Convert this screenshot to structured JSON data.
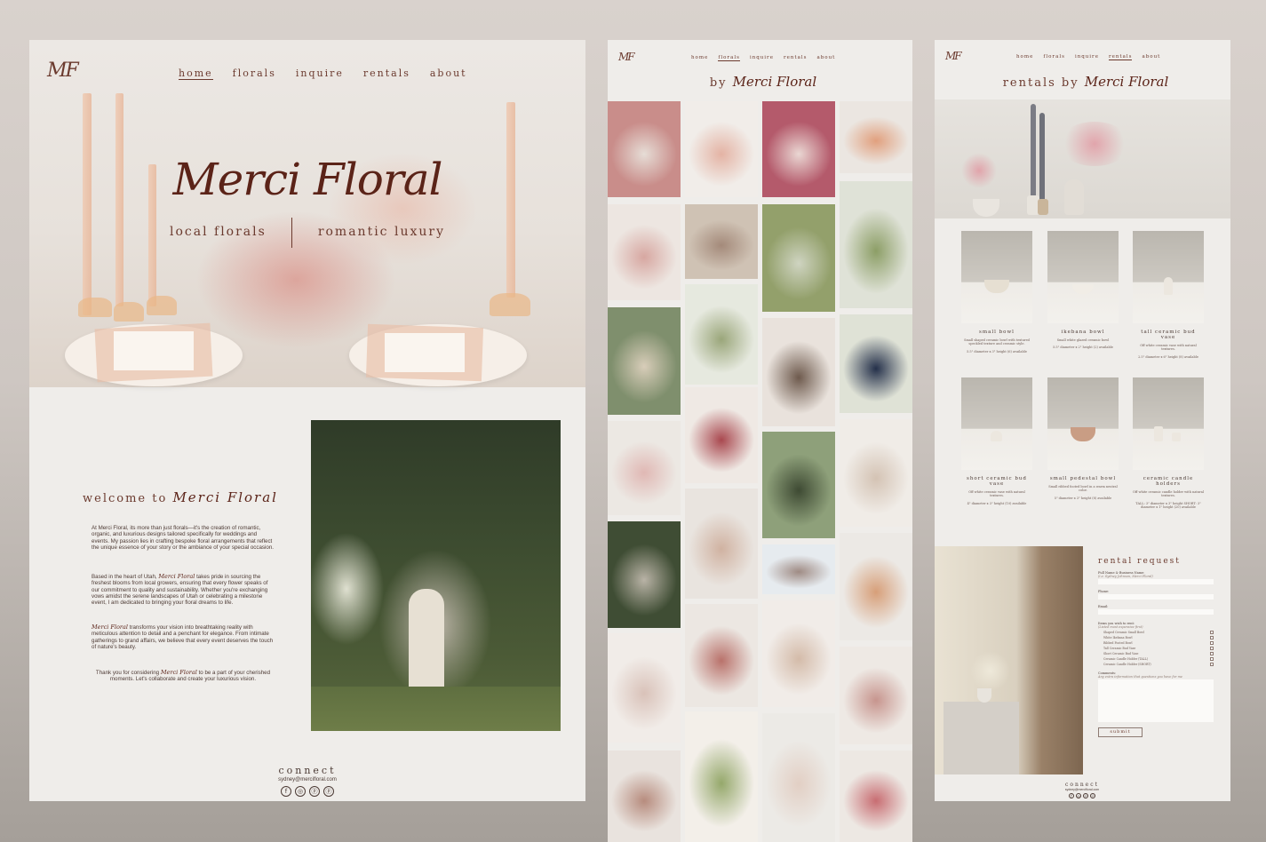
{
  "home": {
    "logo": "MF",
    "nav": [
      "home",
      "florals",
      "inquire",
      "rentals",
      "about"
    ],
    "active_nav": "home",
    "brand": "Merci Floral",
    "tagline_left": "local florals",
    "tagline_right": "romantic luxury",
    "welcome_prefix": "welcome to",
    "welcome_brand": "Merci Floral",
    "para1": "At Merci Floral, its more than just florals—it's the creation of romantic, organic, and luxurious designs tailored specifically for weddings and events. My passion lies in crafting bespoke floral arrangements that reflect the unique essence of your story or the ambiance of your special occasion.",
    "para2_lead": "Based in the heart of Utah,",
    "para2_brand": "Merci Floral",
    "para2_rest": "takes pride in sourcing the freshest blooms from local growers, ensuring that every flower speaks of our commitment to quality and sustainability. Whether you're exchanging vows amidst the serene landscapes of Utah or celebrating a milestone event, I am dedicated to bringing your floral dreams to life.",
    "para3_brand": "Merci Floral",
    "para3_rest": "transforms your vision into breathtaking reality with meticulous attention to detail and a penchant for elegance. From intimate gatherings to grand affairs, we believe that every event deserves the touch of nature's beauty.",
    "para4_lead": "Thank you for considering",
    "para4_brand": "Merci Floral",
    "para4_rest": "to be a part of your cherished moments. Let's collaborate and create your luxurious vision.",
    "connect_title": "connect",
    "email": "sydney@mercifloral.com",
    "socials": [
      "f",
      "◎",
      "ⓟ",
      "ⓟ"
    ]
  },
  "gallery": {
    "logo": "MF",
    "nav": [
      "home",
      "florals",
      "inquire",
      "rentals",
      "about"
    ],
    "active_nav": "florals",
    "title_prefix": "by",
    "title_brand": "Merci Floral"
  },
  "rentals": {
    "logo": "MF",
    "nav": [
      "home",
      "florals",
      "inquire",
      "rentals",
      "about"
    ],
    "active_nav": "rentals",
    "title_prefix": "rentals by",
    "title_brand": "Merci Floral",
    "products": [
      {
        "name": "small bowl",
        "desc": "Small shaped ceramic bowl with textured speckled texture and ceramic style.",
        "dims": "5.5\" diameter x 3\" height (6) available"
      },
      {
        "name": "ikebana bowl",
        "desc": "Small white glazed ceramic bowl",
        "dims": "5.5\" diameter x 2\" height (2) available"
      },
      {
        "name": "tall ceramic bud vase",
        "desc": "Off white ceramic vase with natural textures.",
        "dims": "2.5\" diameter x 6\" height (8) available"
      },
      {
        "name": "short ceramic bud vase",
        "desc": "Off white ceramic vase with natural textures.",
        "dims": "4\" diameter x 3\" height (10) available"
      },
      {
        "name": "small pedestal bowl",
        "desc": "Small ribbed footed bowl in a warm neutral color.",
        "dims": "5\" diameter x 3\" height (8) available"
      },
      {
        "name": "ceramic candle holders",
        "desc": "Off white ceramic candle holder with natural textures.",
        "dims": "TALL: 3\" diameter x 3\" height SHORT: 3\" diameter x 1\" height (20) available"
      }
    ],
    "form": {
      "title": "rental request",
      "fields": [
        "Full Name & Business Name:",
        "Phone:",
        "Email:"
      ],
      "field_hint": "(i.e. Sydney Johnson, Merci Floral)",
      "items_label": "Items you wish to rent:",
      "items_hint": "(Listed most expensive first)",
      "items": [
        "Shaped Ceramic Small Bowl",
        "White Ikebana Bowl",
        "Ribbed Footed Bowl",
        "Tall Ceramic Bud Vase",
        "Short Ceramic Bud Vase",
        "Ceramic Candle Holder (TALL)",
        "Ceramic Candle Holder (SHORT)"
      ],
      "comments_label": "Comments:",
      "comments_hint": "Any extra information that questions you have for me",
      "submit": "submit"
    },
    "connect_title": "connect",
    "email": "sydney@mercifloral.com",
    "socials": [
      "f",
      "◎",
      "ⓟ",
      "ⓟ"
    ]
  },
  "colors": {
    "panel_bg": "#efedea",
    "brand_text": "#5b2318",
    "nav_text": "#6b3a2e"
  }
}
